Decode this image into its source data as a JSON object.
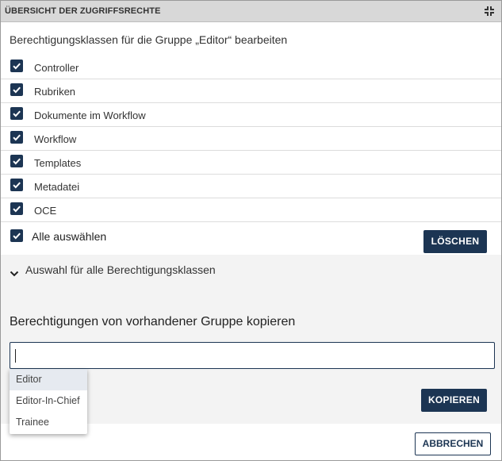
{
  "dialog": {
    "title": "ÜBERSICHT DER ZUGRIFFSRECHTE",
    "collapse_icon": "collapse-arrows-icon"
  },
  "intro_text": "Berechtigungsklassen für die Gruppe „Editor“ bearbeiten",
  "permissions": [
    {
      "label": "Controller",
      "checked": true
    },
    {
      "label": "Rubriken",
      "checked": true
    },
    {
      "label": "Dokumente im Workflow",
      "checked": true
    },
    {
      "label": "Workflow",
      "checked": true
    },
    {
      "label": "Templates",
      "checked": true
    },
    {
      "label": "Metadatei",
      "checked": true
    },
    {
      "label": "OCE",
      "checked": true
    }
  ],
  "select_all": {
    "label": "Alle auswählen",
    "checked": true
  },
  "buttons": {
    "delete": "LÖSCHEN",
    "copy": "KOPIEREN",
    "cancel": "ABBRECHEN"
  },
  "expander": {
    "label": "Auswahl für alle Berechtigungsklassen",
    "icon": "chevron-down-icon"
  },
  "copy_section": {
    "title": "Berechtigungen von vorhandener Gruppe kopieren",
    "input_value": "",
    "options": [
      "Editor",
      "Editor-In-Chief",
      "Trainee"
    ],
    "highlighted_option": "Editor"
  },
  "colors": {
    "accent": "#1c3553",
    "titlebar": "#d8d8d8",
    "section_bg": "#f3f3f3"
  }
}
